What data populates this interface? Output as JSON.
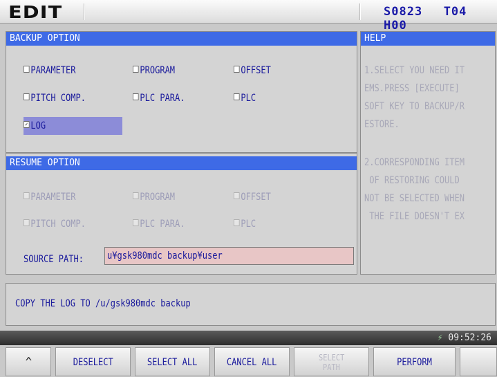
{
  "header": {
    "mode": "EDIT",
    "status_s": "S0823",
    "status_t": "T04",
    "status_h": "H00"
  },
  "backup": {
    "title": "BACKUP OPTION",
    "options": [
      {
        "label": "PARAMETER",
        "checked": false
      },
      {
        "label": "PROGRAM",
        "checked": false
      },
      {
        "label": "OFFSET",
        "checked": false
      },
      {
        "label": "PITCH COMP.",
        "checked": false
      },
      {
        "label": "PLC PARA.",
        "checked": false
      },
      {
        "label": "PLC",
        "checked": false
      },
      {
        "label": "LOG",
        "checked": true
      }
    ]
  },
  "resume": {
    "title": "RESUME OPTION",
    "options": [
      {
        "label": "PARAMETER"
      },
      {
        "label": "PROGRAM"
      },
      {
        "label": "OFFSET"
      },
      {
        "label": "PITCH COMP."
      },
      {
        "label": "PLC PARA."
      },
      {
        "label": "PLC"
      }
    ],
    "source_label": "SOURCE PATH:",
    "source_value": "u¥gsk980mdc backup¥user"
  },
  "help": {
    "title": "HELP",
    "lines": [
      "1.SELECT YOU NEED IT",
      "EMS.PRESS [EXECUTE]",
      "SOFT KEY TO BACKUP/R",
      "ESTORE.",
      "2.CORRESPONDING ITEM",
      " OF RESTORING COULD",
      "NOT BE SELECTED WHEN",
      " THE FILE DOESN'T EX"
    ]
  },
  "message": "COPY THE LOG TO /u/gsk980mdc backup",
  "clock": "09:52:26",
  "softkeys": {
    "back": "^",
    "deselect": "DESELECT",
    "select_all": "SELECT ALL",
    "cancel_all": "CANCEL ALL",
    "select_path_1": "SELECT",
    "select_path_2": "PATH",
    "perform": "PERFORM"
  }
}
